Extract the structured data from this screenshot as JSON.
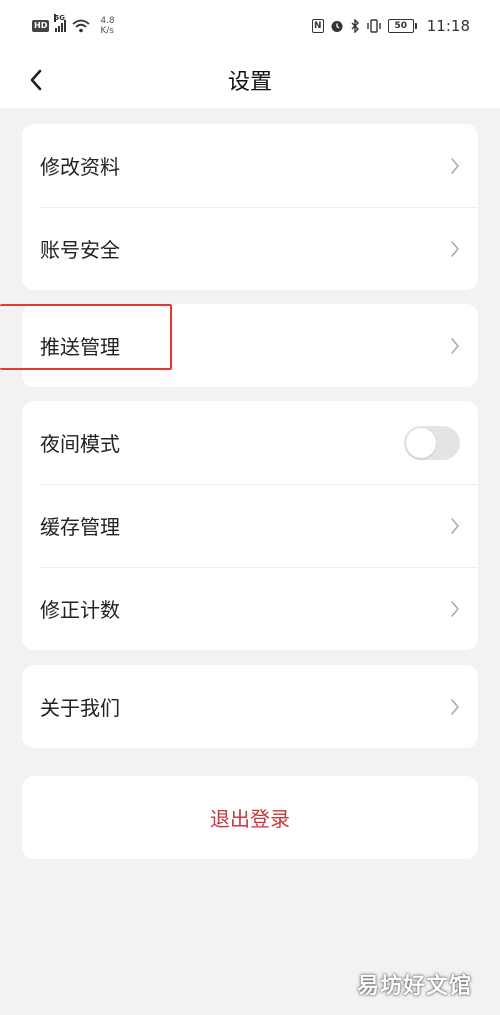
{
  "status_bar": {
    "hd": "HD",
    "network": "5G",
    "speed_value": "4.8",
    "speed_unit": "K/s",
    "battery": "50",
    "time": "11:18",
    "icons": [
      "nfc-icon",
      "alarm-icon",
      "bluetooth-icon",
      "vibrate-icon",
      "battery-icon"
    ]
  },
  "nav": {
    "title": "设置",
    "back_icon": "chevron-left-icon"
  },
  "groups": [
    {
      "items": [
        {
          "label": "修改资料",
          "icon": "chevron-right-icon"
        },
        {
          "label": "账号安全",
          "icon": "chevron-right-icon"
        }
      ]
    },
    {
      "items": [
        {
          "label": "推送管理",
          "icon": "chevron-right-icon"
        }
      ]
    },
    {
      "items": [
        {
          "label": "夜间模式",
          "control": "toggle",
          "toggle_on": false
        },
        {
          "label": "缓存管理",
          "icon": "chevron-right-icon"
        },
        {
          "label": "修正计数",
          "icon": "chevron-right-icon"
        }
      ]
    },
    {
      "items": [
        {
          "label": "关于我们",
          "icon": "chevron-right-icon"
        }
      ]
    }
  ],
  "logout": {
    "label": "退出登录",
    "color": "#c8373b"
  },
  "annotation": {
    "highlight_color": "#e53935"
  },
  "watermark": "易坊好文馆"
}
